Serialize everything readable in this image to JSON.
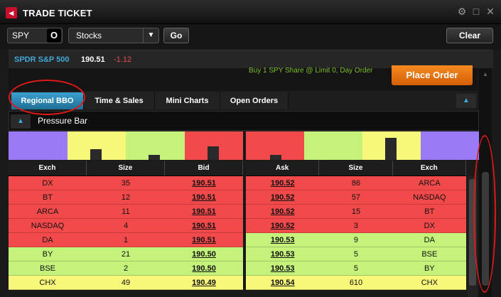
{
  "window": {
    "title": "TRADE TICKET",
    "logo_glyph": "◂"
  },
  "toolbar": {
    "symbol_value": "SPY",
    "symbol_go_glyph": "O",
    "type_select": "Stocks",
    "go_label": "Go",
    "clear_label": "Clear"
  },
  "quote": {
    "name": "SPDR S&P 500",
    "price": "190.51",
    "change": "-1.12"
  },
  "order": {
    "summary": "Buy 1 SPY Share @ Limit 0, Day Order",
    "place_label": "Place Order"
  },
  "tabs": [
    {
      "label": "Regional BBO",
      "active": true
    },
    {
      "label": "Time & Sales",
      "active": false
    },
    {
      "label": "Mini Charts",
      "active": false
    },
    {
      "label": "Open Orders",
      "active": false
    }
  ],
  "pressure": {
    "label": "Pressure Bar"
  },
  "colors": {
    "red": "#f24a4a",
    "yellow": "#f7f77a",
    "green": "#c4f27a",
    "purple": "#9a7af7",
    "blue_accent": "#3fa9d8",
    "orange": "#f07a16"
  },
  "bid_book": {
    "headers": [
      "Exch",
      "Size",
      "Bid"
    ],
    "rows": [
      {
        "exch": "DX",
        "size": "35",
        "price": "190.51",
        "color": "#f24a4a"
      },
      {
        "exch": "BT",
        "size": "12",
        "price": "190.51",
        "color": "#f24a4a"
      },
      {
        "exch": "ARCA",
        "size": "11",
        "price": "190.51",
        "color": "#f24a4a"
      },
      {
        "exch": "NASDAQ",
        "size": "4",
        "price": "190.51",
        "color": "#f24a4a"
      },
      {
        "exch": "DA",
        "size": "1",
        "price": "190.51",
        "color": "#f24a4a"
      },
      {
        "exch": "BY",
        "size": "21",
        "price": "190.50",
        "color": "#c4f27a"
      },
      {
        "exch": "BSE",
        "size": "2",
        "price": "190.50",
        "color": "#c4f27a"
      },
      {
        "exch": "CHX",
        "size": "49",
        "price": "190.49",
        "color": "#f7f77a"
      }
    ]
  },
  "ask_book": {
    "headers": [
      "Ask",
      "Size",
      "Exch"
    ],
    "rows": [
      {
        "price": "190.52",
        "size": "86",
        "exch": "ARCA",
        "color": "#f24a4a"
      },
      {
        "price": "190.52",
        "size": "57",
        "exch": "NASDAQ",
        "color": "#f24a4a"
      },
      {
        "price": "190.52",
        "size": "15",
        "exch": "BT",
        "color": "#f24a4a"
      },
      {
        "price": "190.52",
        "size": "3",
        "exch": "DX",
        "color": "#f24a4a"
      },
      {
        "price": "190.53",
        "size": "9",
        "exch": "DA",
        "color": "#c4f27a"
      },
      {
        "price": "190.53",
        "size": "5",
        "exch": "BSE",
        "color": "#c4f27a"
      },
      {
        "price": "190.53",
        "size": "5",
        "exch": "BY",
        "color": "#c4f27a"
      },
      {
        "price": "190.54",
        "size": "610",
        "exch": "CHX",
        "color": "#f7f77a"
      }
    ]
  }
}
